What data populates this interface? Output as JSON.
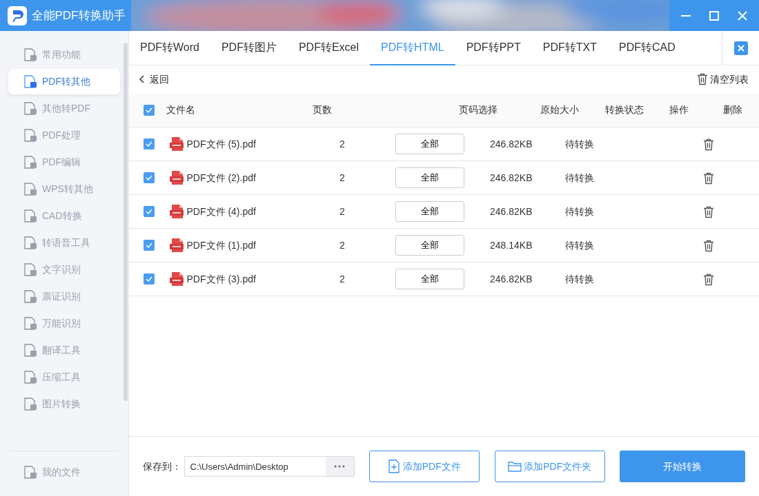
{
  "window": {
    "title": "全能PDF转换助手"
  },
  "sidebar": {
    "items": [
      {
        "label": "常用功能",
        "selected": false
      },
      {
        "label": "PDF转其他",
        "selected": true
      },
      {
        "label": "其他转PDF",
        "selected": false
      },
      {
        "label": "PDF处理",
        "selected": false
      },
      {
        "label": "PDF编辑",
        "selected": false
      },
      {
        "label": "WPS转其他",
        "selected": false
      },
      {
        "label": "CAD转换",
        "selected": false
      },
      {
        "label": "转语音工具",
        "selected": false
      },
      {
        "label": "文字识别",
        "selected": false
      },
      {
        "label": "票证识别",
        "selected": false
      },
      {
        "label": "万能识别",
        "selected": false
      },
      {
        "label": "翻译工具",
        "selected": false
      },
      {
        "label": "压缩工具",
        "selected": false
      },
      {
        "label": "图片转换",
        "selected": false
      }
    ],
    "footer_item": {
      "label": "我的文件"
    }
  },
  "tabs": [
    {
      "label": "PDF转Word",
      "selected": false
    },
    {
      "label": "PDF转图片",
      "selected": false
    },
    {
      "label": "PDF转Excel",
      "selected": false
    },
    {
      "label": "PDF转HTML",
      "selected": true
    },
    {
      "label": "PDF转PPT",
      "selected": false
    },
    {
      "label": "PDF转TXT",
      "selected": false
    },
    {
      "label": "PDF转CAD",
      "selected": false
    }
  ],
  "toolbar": {
    "back": "返回",
    "clear": "清空列表"
  },
  "table": {
    "all_checked": true,
    "columns": [
      "文件名",
      "页数",
      "页码选择",
      "原始大小",
      "转换状态",
      "操作",
      "删除"
    ],
    "rows": [
      {
        "checked": true,
        "name": "PDF文件 (5).pdf",
        "pages": "2",
        "range": "全部",
        "size": "246.82KB",
        "status": "待转换"
      },
      {
        "checked": true,
        "name": "PDF文件 (2).pdf",
        "pages": "2",
        "range": "全部",
        "size": "246.82KB",
        "status": "待转换"
      },
      {
        "checked": true,
        "name": "PDF文件 (4).pdf",
        "pages": "2",
        "range": "全部",
        "size": "246.82KB",
        "status": "待转换"
      },
      {
        "checked": true,
        "name": "PDF文件 (1).pdf",
        "pages": "2",
        "range": "全部",
        "size": "248.14KB",
        "status": "待转换"
      },
      {
        "checked": true,
        "name": "PDF文件 (3).pdf",
        "pages": "2",
        "range": "全部",
        "size": "246.82KB",
        "status": "待转换"
      }
    ]
  },
  "footer": {
    "save_label": "保存到：",
    "path": "C:\\Users\\Admin\\Desktop",
    "add_file": "添加PDF文件",
    "add_folder": "添加PDF文件夹",
    "start": "开始转换"
  }
}
